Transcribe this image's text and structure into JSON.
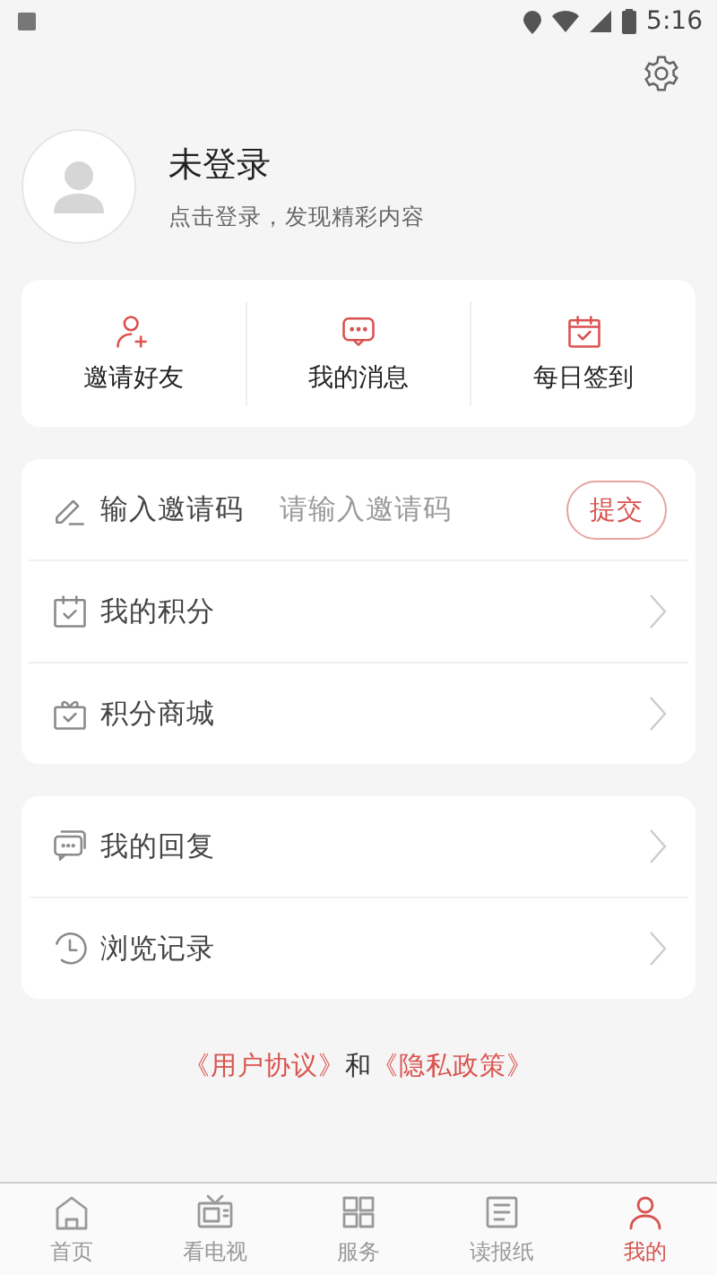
{
  "status_bar": {
    "time": "5:16"
  },
  "profile": {
    "name": "未登录",
    "hint": "点击登录，发现精彩内容"
  },
  "quick_actions": [
    {
      "kind": "invite",
      "label": "邀请好友"
    },
    {
      "kind": "messages",
      "label": "我的消息"
    },
    {
      "kind": "checkin",
      "label": "每日签到"
    }
  ],
  "invite_code": {
    "label": "输入邀请码",
    "placeholder": "请输入邀请码",
    "button": "提交"
  },
  "menu_group_1": [
    {
      "kind": "points",
      "label": "我的积分"
    },
    {
      "kind": "mall",
      "label": "积分商城"
    }
  ],
  "menu_group_2": [
    {
      "kind": "replies",
      "label": "我的回复"
    },
    {
      "kind": "history",
      "label": "浏览记录"
    }
  ],
  "agreement": {
    "user_agreement": "《用户协议》",
    "conjunction": "和",
    "privacy_policy": "《隐私政策》"
  },
  "tab_bar": [
    {
      "kind": "home",
      "label": "首页",
      "selected": false
    },
    {
      "kind": "tv",
      "label": "看电视",
      "selected": false
    },
    {
      "kind": "service",
      "label": "服务",
      "selected": false
    },
    {
      "kind": "paper",
      "label": "读报纸",
      "selected": false
    },
    {
      "kind": "me",
      "label": "我的",
      "selected": true
    }
  ]
}
